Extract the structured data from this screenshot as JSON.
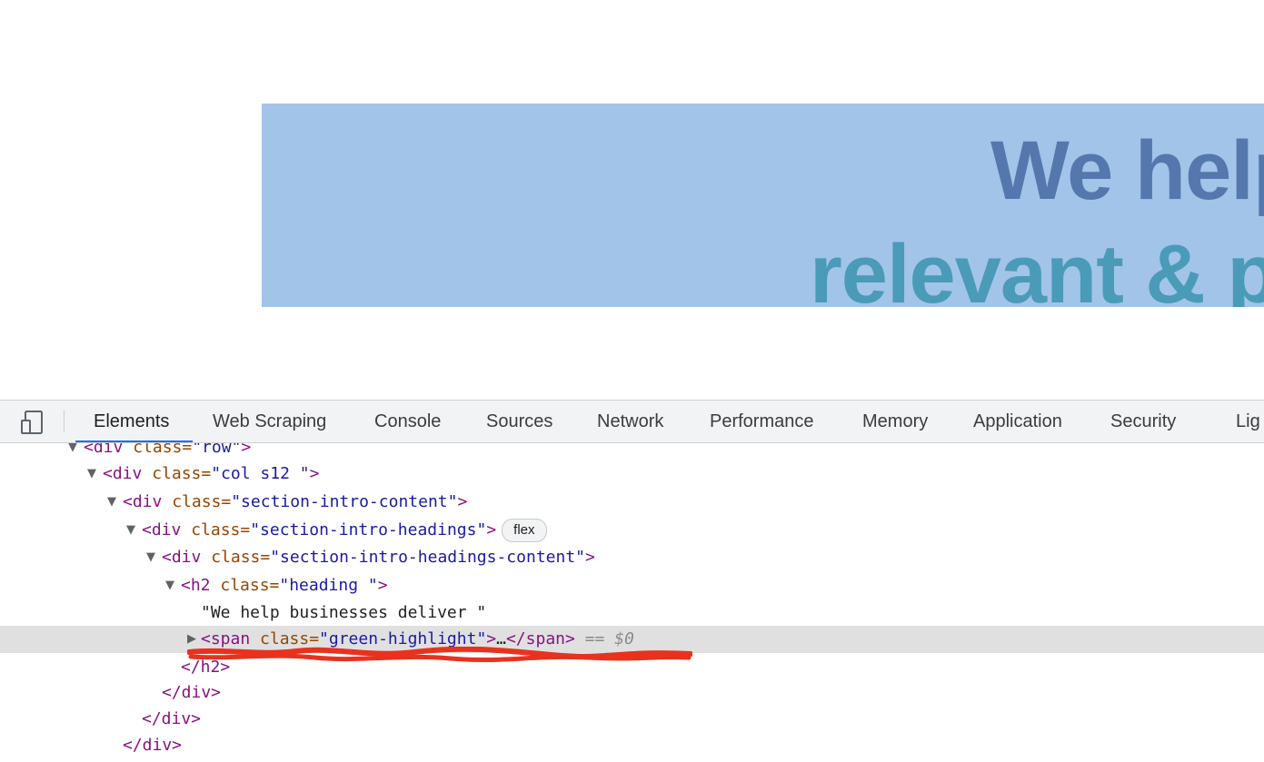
{
  "page": {
    "heading_line1": "We help",
    "heading_line2": "relevant & p",
    "highlight_color": "#a2c4e8",
    "heading_color1": "#5478ad",
    "heading_color2": "#4a9bb8"
  },
  "devtools": {
    "device_toggle_icon": "device-toolbar-icon",
    "tabs": [
      {
        "label": "Elements",
        "active": true
      },
      {
        "label": "Web Scraping"
      },
      {
        "label": "Console"
      },
      {
        "label": "Sources"
      },
      {
        "label": "Network"
      },
      {
        "label": "Performance"
      },
      {
        "label": "Memory"
      },
      {
        "label": "Application"
      },
      {
        "label": "Security"
      },
      {
        "label": "Lig"
      }
    ],
    "accent_color": "#1a73e8"
  },
  "dom": {
    "line0": {
      "open": "<div",
      "attr": " class=",
      "val": "\"row\"",
      "close": ">"
    },
    "line1": {
      "open": "<div",
      "attr": " class=",
      "val": "\"col s12 \"",
      "close": ">"
    },
    "line2": {
      "open": "<div",
      "attr": " class=",
      "val": "\"section-intro-content\"",
      "close": ">"
    },
    "line3": {
      "open": "<div",
      "attr": " class=",
      "val": "\"section-intro-headings\"",
      "close": ">",
      "badge": "flex"
    },
    "line4": {
      "open": "<div",
      "attr": " class=",
      "val": "\"section-intro-headings-content\"",
      "close": ">"
    },
    "line5": {
      "open": "<h2",
      "attr": " class=",
      "val": "\"heading  \"",
      "close": ">"
    },
    "line6": {
      "text": "\"We help businesses deliver \""
    },
    "line7": {
      "open": "<span",
      "attr": " class=",
      "val": "\"green-highlight\"",
      "close": ">",
      "ellipsis": "…",
      "end": "</span>",
      "eq": " == ",
      "dollar": "$0"
    },
    "line8": {
      "end": "</h2>"
    },
    "line9": {
      "end": "</div>"
    },
    "line10": {
      "end": "</div>"
    },
    "line11": {
      "end": "</div>"
    }
  }
}
